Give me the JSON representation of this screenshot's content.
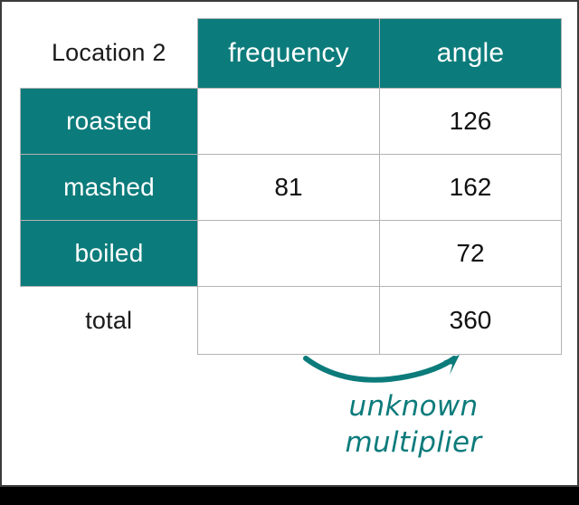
{
  "slide": {
    "background_color": "#ffffff",
    "accent_color": "#0c7b7b",
    "border_color": "#b3b3b3"
  },
  "table": {
    "corner_label": "Location 2",
    "columns": [
      "frequency",
      "angle"
    ],
    "rows": [
      {
        "label": "roasted",
        "label_style": "accent",
        "frequency": "",
        "angle": "126"
      },
      {
        "label": "mashed",
        "label_style": "accent",
        "frequency": "81",
        "angle": "162"
      },
      {
        "label": "boiled",
        "label_style": "accent",
        "frequency": "",
        "angle": "72"
      },
      {
        "label": "total",
        "label_style": "plain",
        "frequency": "",
        "angle": "360"
      }
    ]
  },
  "annotation": {
    "arrow_icon": "curved-arrow-icon",
    "line1": "unknown",
    "line2": "multiplier",
    "color": "#0c7b7b"
  }
}
